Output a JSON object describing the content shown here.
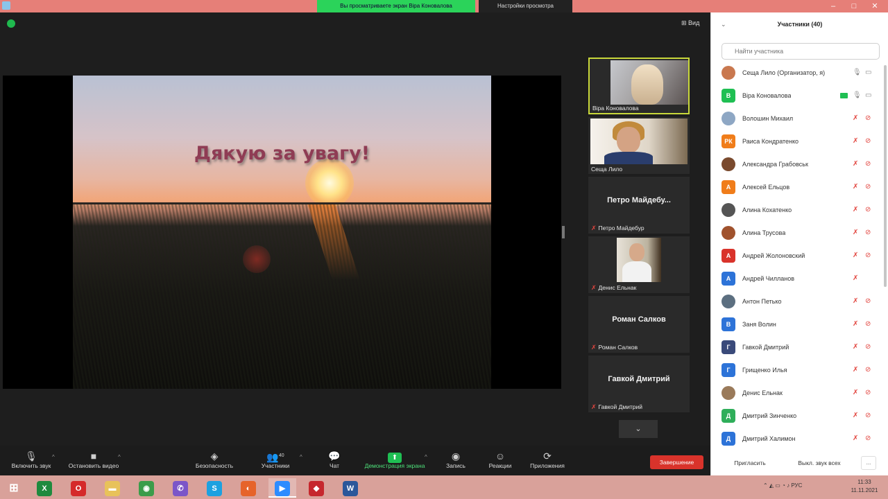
{
  "topbar": {
    "banner_left": "Вы просматриваете экран Віра Коновалова",
    "banner_right": "Настройки просмотра",
    "minimize": "–",
    "maximize": "□",
    "close": "✕"
  },
  "meeting": {
    "view_label": "Вид",
    "slide_title": "Дякую за увагу!"
  },
  "tiles": [
    {
      "label": "Віра Коновалова",
      "type": "video",
      "active": true
    },
    {
      "label": "Сеща Лило",
      "type": "video"
    },
    {
      "big": "Петро Майдебу...",
      "label": "Петро Майдебур",
      "type": "name",
      "muted": true
    },
    {
      "label": "Денис Ельнак",
      "type": "video",
      "muted": true
    },
    {
      "big": "Роман Салков",
      "label": "Роман Салков",
      "type": "name",
      "muted": true
    },
    {
      "big": "Гавкой Дмитрий",
      "label": "Гавкой Дмитрий",
      "type": "name",
      "muted": true
    }
  ],
  "toolbar": {
    "audio": "Включить звук",
    "video": "Остановить видео",
    "security": "Безопасность",
    "participants": "Участники",
    "participants_count": "40",
    "chat": "Чат",
    "share": "Демонстрация экрана",
    "record": "Запись",
    "reactions": "Реакции",
    "apps": "Приложения",
    "end": "Завершение"
  },
  "panel": {
    "title": "Участники (40)",
    "search_placeholder": "Найти участника",
    "invite": "Пригласить",
    "mute_all": "Выкл. звук всех",
    "more": "...",
    "participants": [
      {
        "name": "Сеща Лило (Организатор, я)",
        "initials": "",
        "color": "#c9784f",
        "mic": "on",
        "cam": "on"
      },
      {
        "name": "Віра Коновалова",
        "initials": "В",
        "color": "#1fbf53",
        "mic": "on",
        "cam": "on",
        "sharing": true
      },
      {
        "name": "Волошин Михаил",
        "initials": "",
        "color": "#8ea7c4",
        "mic": "off",
        "cam": "off"
      },
      {
        "name": "Раиса Кондратенко",
        "initials": "РК",
        "color": "#f07d1a",
        "mic": "off",
        "cam": "off"
      },
      {
        "name": "Александра Грабовськ",
        "initials": "",
        "color": "#7a4a2e",
        "mic": "off",
        "cam": "off"
      },
      {
        "name": "Алексей Ельцов",
        "initials": "А",
        "color": "#f07d1a",
        "mic": "off",
        "cam": "off"
      },
      {
        "name": "Алина Кохатенко",
        "initials": "",
        "color": "#555555",
        "mic": "off",
        "cam": "off"
      },
      {
        "name": "Алина Трусова",
        "initials": "",
        "color": "#a0522d",
        "mic": "off",
        "cam": "off"
      },
      {
        "name": "Андрей Жолоновский",
        "initials": "А",
        "color": "#d9332b",
        "mic": "off",
        "cam": "off"
      },
      {
        "name": "Андрей Чилланов",
        "initials": "А",
        "color": "#2d73d8",
        "mic": "off",
        "cam": "none"
      },
      {
        "name": "Антон Петько",
        "initials": "",
        "color": "#5c6f80",
        "mic": "off",
        "cam": "off"
      },
      {
        "name": "Заня Волин",
        "initials": "В",
        "color": "#2d73d8",
        "mic": "off",
        "cam": "off"
      },
      {
        "name": "Гавкой Дмитрий",
        "initials": "Г",
        "color": "#3a4a7a",
        "mic": "off",
        "cam": "off"
      },
      {
        "name": "Грищенко Илья",
        "initials": "Г",
        "color": "#2d73d8",
        "mic": "off",
        "cam": "off"
      },
      {
        "name": "Денис Ельнак",
        "initials": "",
        "color": "#9a7a5a",
        "mic": "off",
        "cam": "off"
      },
      {
        "name": "Дмитрий Зинченко",
        "initials": "Д",
        "color": "#2fae5a",
        "mic": "off",
        "cam": "off"
      },
      {
        "name": "Дмитрий Халимон",
        "initials": "Д",
        "color": "#2d73d8",
        "mic": "off",
        "cam": "off"
      }
    ]
  },
  "taskbar": {
    "apps": [
      {
        "name": "windows-start",
        "glyph": "⊞",
        "color": "#ffffff"
      },
      {
        "name": "excel",
        "glyph": "X",
        "color": "#1f8a3e"
      },
      {
        "name": "opera",
        "glyph": "O",
        "color": "#d52a2a"
      },
      {
        "name": "file-explorer",
        "glyph": "▬",
        "color": "#e8c25a"
      },
      {
        "name": "chrome",
        "glyph": "◉",
        "color": "#3b9c4a"
      },
      {
        "name": "viber",
        "glyph": "✆",
        "color": "#7b56c8"
      },
      {
        "name": "skype",
        "glyph": "S",
        "color": "#1ca1e0"
      },
      {
        "name": "firefox",
        "glyph": "◐",
        "color": "#e6632a"
      },
      {
        "name": "zoom",
        "glyph": "▶",
        "color": "#2d8cff"
      },
      {
        "name": "pdf-reader",
        "glyph": "◆",
        "color": "#c6272d"
      },
      {
        "name": "word",
        "glyph": "W",
        "color": "#2b579a"
      }
    ],
    "lang": "РУС",
    "time": "11:33",
    "date": "11.11.2021"
  }
}
